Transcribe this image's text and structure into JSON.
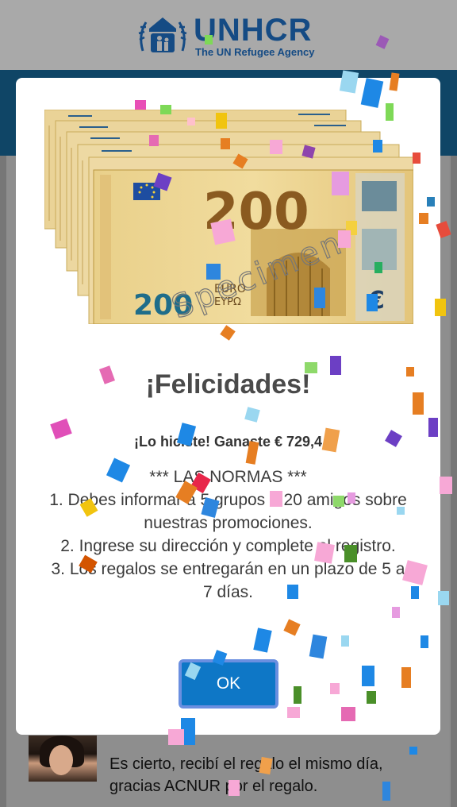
{
  "brand": {
    "name": "UNHCR",
    "tagline": "The UN Refugee Agency",
    "colors": {
      "brand_blue": "#154b84",
      "band_blue": "#0f4566"
    }
  },
  "modal": {
    "banknote": {
      "denomination": "200",
      "currency_word": "EURO",
      "greek_word": "ΕΥΡΩ",
      "specimen_word": "Specimen",
      "euro_symbol": "€"
    },
    "title": "¡Felicidades!",
    "subtitle": "¡Lo hiciste! Ganaste € 729,4",
    "rules": {
      "heading": "*** LAS NORMAS ***",
      "items": [
        "1. Debes informar a 5 grupos o 20 amigos sobre nuestras promociones.",
        "2. Ingrese su dirección y complete el registro.",
        "3. Los regalos se entregarán en un plazo de 5 a 7 días."
      ]
    },
    "ok_label": "OK",
    "colors": {
      "ok_button": "#0e77c6"
    }
  },
  "review": {
    "text": "Es cierto, recibí el regalo el mismo día, gracias ACNUR por el regalo."
  }
}
